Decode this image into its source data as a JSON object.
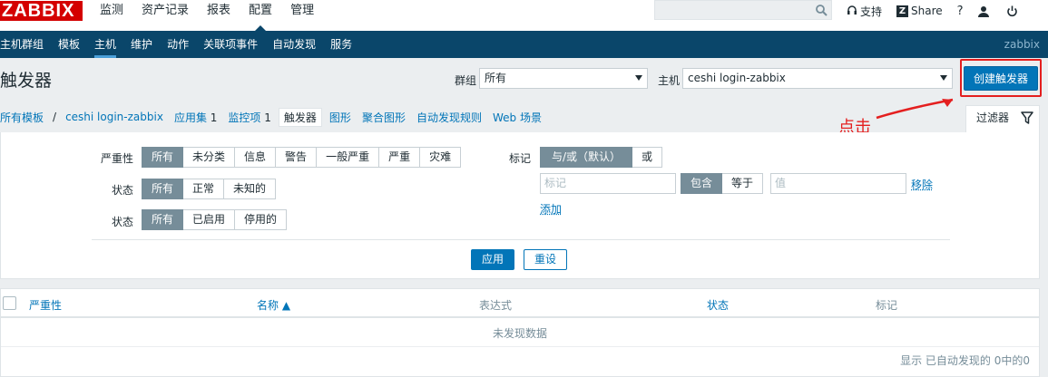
{
  "header": {
    "logo": "ZABBIX",
    "nav": [
      "监测",
      "资产记录",
      "报表",
      "配置",
      "管理"
    ],
    "active_nav": "配置",
    "search_placeholder": "",
    "support_label": "支持",
    "share_label": "Share",
    "help_label": "?",
    "user_icon": "user-icon",
    "logout_icon": "power-icon"
  },
  "subnav": {
    "items": [
      "主机群组",
      "模板",
      "主机",
      "维护",
      "动作",
      "关联项事件",
      "自动发现",
      "服务"
    ],
    "active": "主机",
    "server_name": "zabbix"
  },
  "page": {
    "title": "触发器",
    "group_label": "群组",
    "group_value": "所有",
    "host_label": "主机",
    "host_value": "ceshi login-zabbix",
    "create_button": "创建触发器"
  },
  "breadcrumb": {
    "all_templates": "所有模板",
    "separator": "/",
    "host": "ceshi login-zabbix",
    "applications": "应用集",
    "applications_count": "1",
    "items": "监控项",
    "items_count": "1",
    "triggers": "触发器",
    "graphs": "图形",
    "screens": "聚合图形",
    "discovery": "自动发现规则",
    "web": "Web 场景"
  },
  "annotation": {
    "text": "点击"
  },
  "filter": {
    "tab_label": "过滤器",
    "severity_label": "严重性",
    "severity_options": [
      "所有",
      "未分类",
      "信息",
      "警告",
      "一般严重",
      "严重",
      "灾难"
    ],
    "state_label": "状态",
    "state_options": [
      "所有",
      "正常",
      "未知的"
    ],
    "status_label": "状态",
    "status_options": [
      "所有",
      "已启用",
      "停用的"
    ],
    "tags_label": "标记",
    "tag_mode_options": [
      "与/或（默认）",
      "或"
    ],
    "tag_placeholder": "标记",
    "tag_op_options": [
      "包含",
      "等于"
    ],
    "value_placeholder": "值",
    "remove_label": "移除",
    "add_label": "添加",
    "apply_label": "应用",
    "reset_label": "重设"
  },
  "table": {
    "columns": [
      "严重性",
      "名称 ▲",
      "表达式",
      "状态",
      "标记"
    ],
    "empty_text": "未发现数据",
    "footer_text": "显示 已自动发现的 0中的0"
  },
  "colors": {
    "brand_red": "#d40000",
    "nav_blue": "#0a466a",
    "accent_blue": "#0275b8",
    "annotation_red": "#e41f1f"
  }
}
